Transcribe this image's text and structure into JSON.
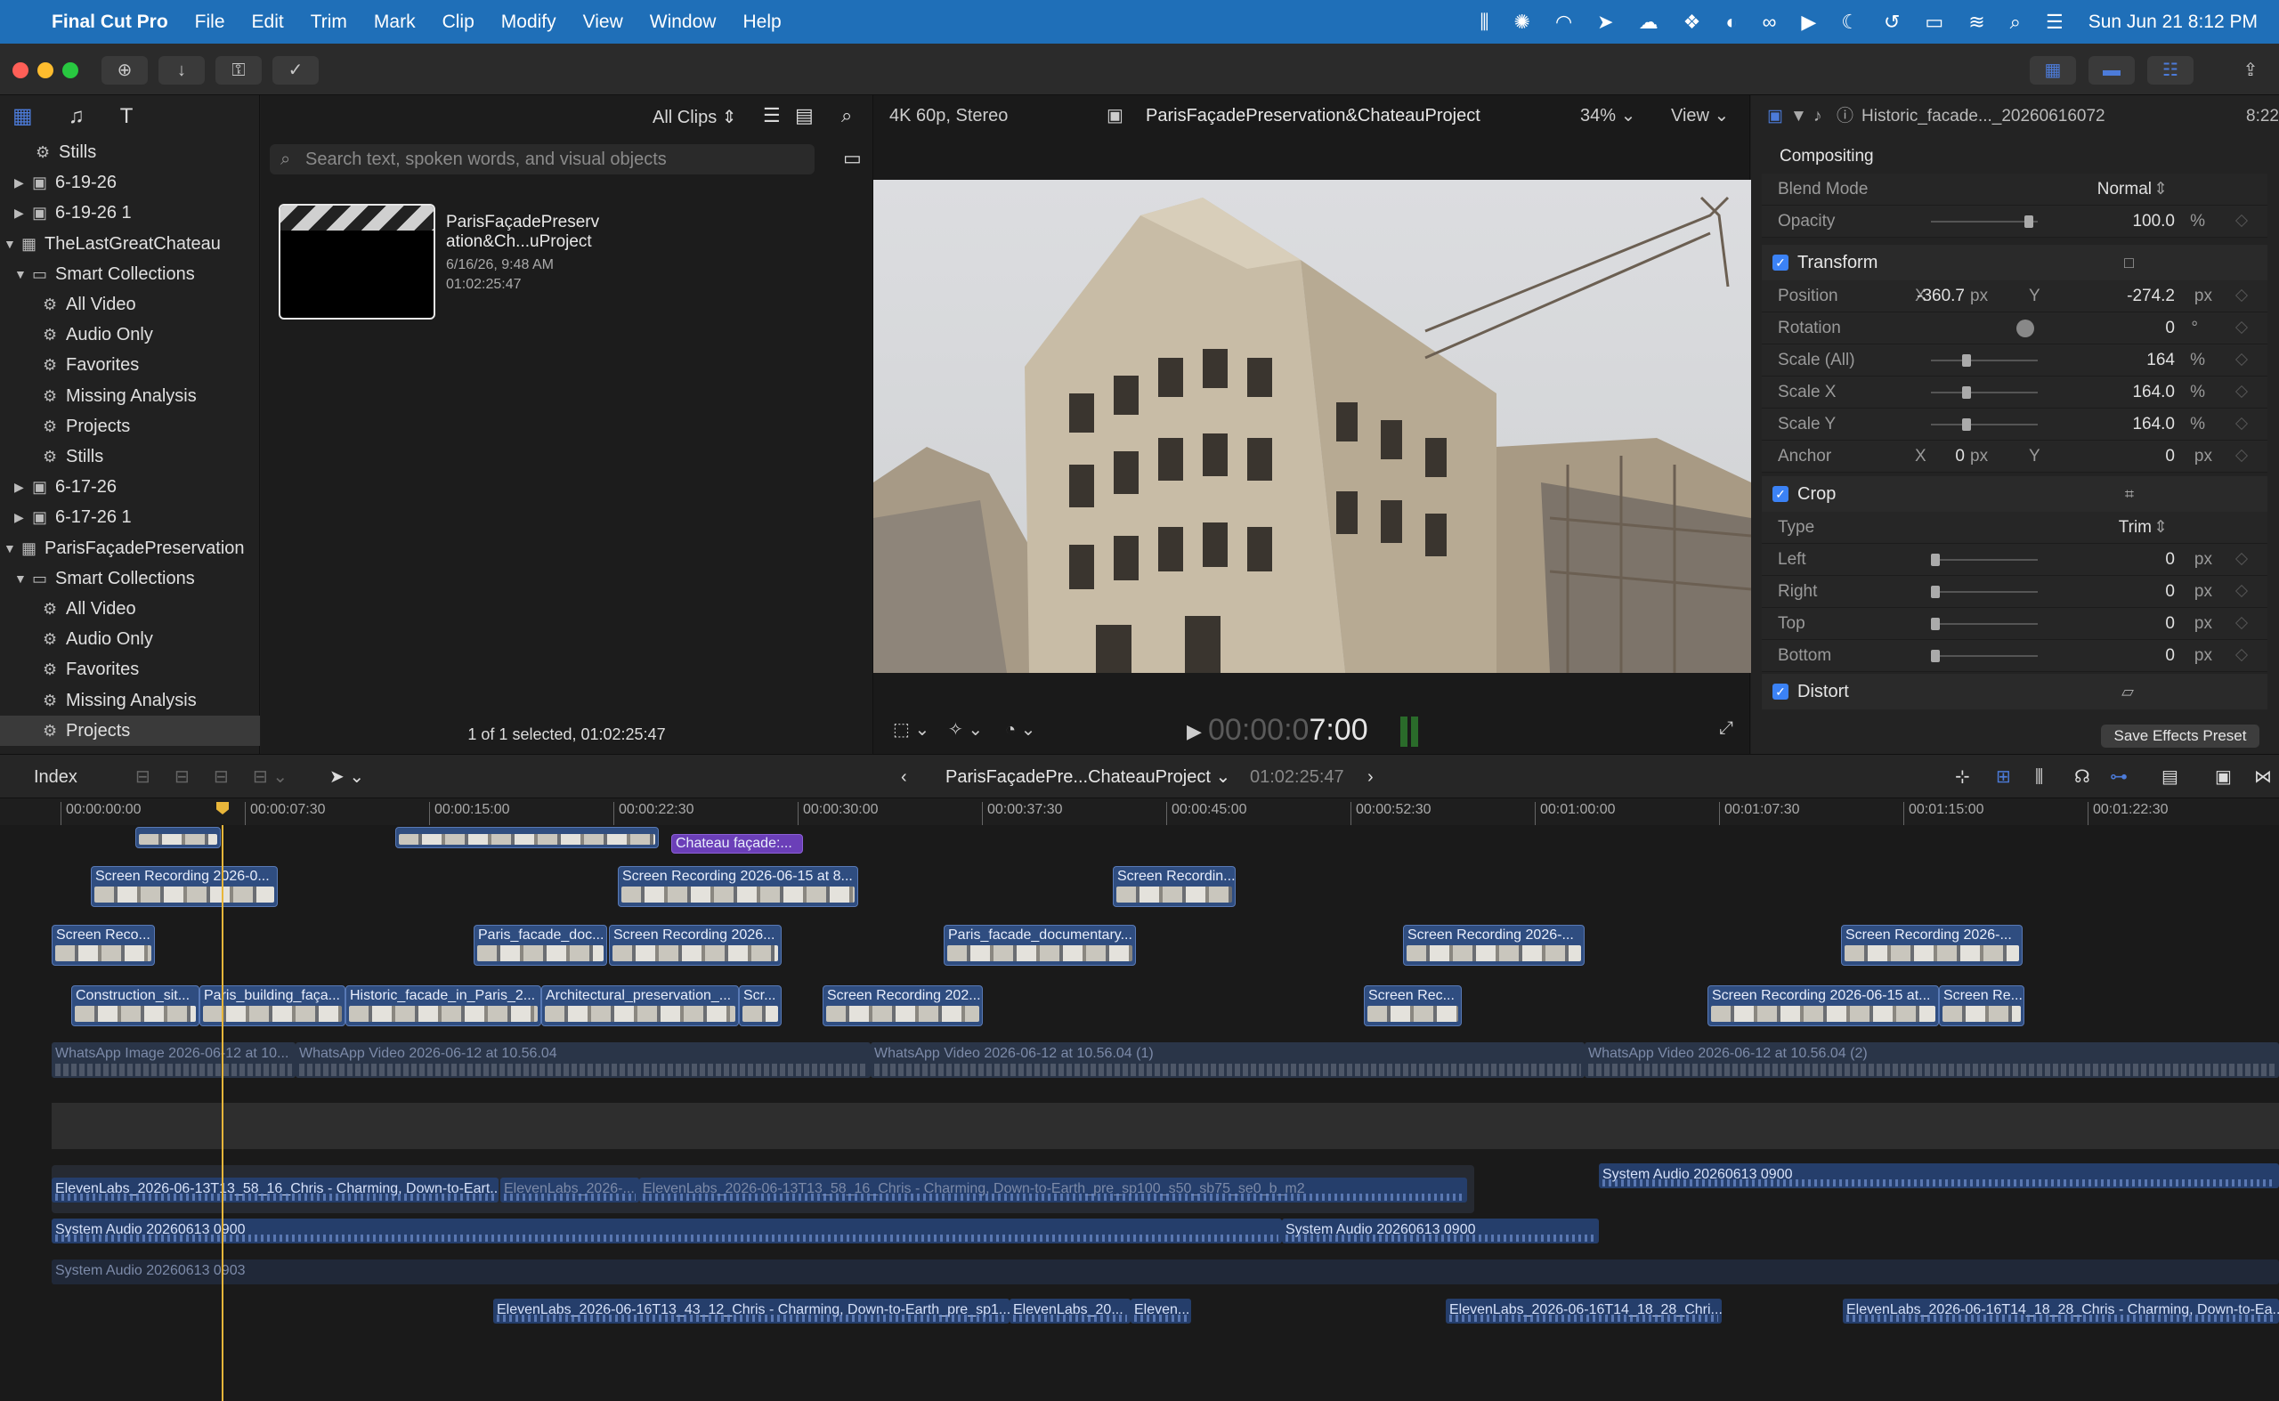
{
  "menubar": {
    "app": "Final Cut Pro",
    "items": [
      "File",
      "Edit",
      "Trim",
      "Mark",
      "Clip",
      "Modify",
      "View",
      "Window",
      "Help"
    ],
    "datetime": "Sun Jun 21  8:12 PM"
  },
  "library": {
    "rows": [
      {
        "label": "Stills",
        "indent": 40,
        "icon": "gear",
        "tri": ""
      },
      {
        "label": "6-19-26",
        "indent": 36,
        "icon": "event",
        "tri": "▶"
      },
      {
        "label": "6-19-26 1",
        "indent": 36,
        "icon": "event",
        "tri": "▶"
      },
      {
        "label": "TheLastGreatChateau",
        "indent": 24,
        "icon": "library",
        "tri": "▼"
      },
      {
        "label": "Smart Collections",
        "indent": 36,
        "icon": "folder",
        "tri": "▼"
      },
      {
        "label": "All Video",
        "indent": 48,
        "icon": "gear",
        "tri": ""
      },
      {
        "label": "Audio Only",
        "indent": 48,
        "icon": "gear",
        "tri": ""
      },
      {
        "label": "Favorites",
        "indent": 48,
        "icon": "gear",
        "tri": ""
      },
      {
        "label": "Missing Analysis",
        "indent": 48,
        "icon": "gear",
        "tri": ""
      },
      {
        "label": "Projects",
        "indent": 48,
        "icon": "gear",
        "tri": ""
      },
      {
        "label": "Stills",
        "indent": 48,
        "icon": "gear",
        "tri": ""
      },
      {
        "label": "6-17-26",
        "indent": 36,
        "icon": "event",
        "tri": "▶"
      },
      {
        "label": "6-17-26 1",
        "indent": 36,
        "icon": "event",
        "tri": "▶"
      },
      {
        "label": "ParisFaçadePreservation",
        "indent": 24,
        "icon": "library",
        "tri": "▼"
      },
      {
        "label": "Smart Collections",
        "indent": 36,
        "icon": "folder",
        "tri": "▼"
      },
      {
        "label": "All Video",
        "indent": 48,
        "icon": "gear",
        "tri": ""
      },
      {
        "label": "Audio Only",
        "indent": 48,
        "icon": "gear",
        "tri": ""
      },
      {
        "label": "Favorites",
        "indent": 48,
        "icon": "gear",
        "tri": ""
      },
      {
        "label": "Missing Analysis",
        "indent": 48,
        "icon": "gear",
        "tri": ""
      },
      {
        "label": "Projects",
        "indent": 48,
        "icon": "gear",
        "tri": "",
        "selected": true
      }
    ]
  },
  "browser": {
    "filter": "All Clips",
    "search_placeholder": "Search text, spoken words, and visual objects",
    "clip": {
      "title_line1": "ParisFaçadePreserv",
      "title_line2": "ation&Ch...uProject",
      "date": "6/16/26, 9:48 AM",
      "duration": "01:02:25:47"
    },
    "footer": "1 of 1 selected, 01:02:25:47"
  },
  "viewer": {
    "format": "4K 60p, Stereo",
    "project": "ParisFaçadePreservation&ChateauProject",
    "zoom": "34%",
    "view": "View",
    "timecode_dim": "00:00:0",
    "timecode_bright": "7:00"
  },
  "inspector": {
    "clip_name": "Historic_facade..._20260616072",
    "clip_time": "8:22",
    "compositing": "Compositing",
    "blend_mode_label": "Blend Mode",
    "blend_mode": "Normal",
    "opacity_label": "Opacity",
    "opacity": "100.0",
    "pct": "%",
    "transform": "Transform",
    "position_label": "Position",
    "x": "X",
    "y": "Y",
    "pos_x": "-360.7",
    "pos_y": "-274.2",
    "px": "px",
    "rotation_label": "Rotation",
    "rotation": "0",
    "deg": "°",
    "scale_all_label": "Scale (All)",
    "scale_all": "164",
    "scale_x_label": "Scale X",
    "scale_x": "164.0",
    "scale_y_label": "Scale Y",
    "scale_y": "164.0",
    "anchor_label": "Anchor",
    "anchor_x": "0",
    "anchor_y": "0",
    "crop": "Crop",
    "type_label": "Type",
    "type": "Trim",
    "left_label": "Left",
    "right_label": "Right",
    "top_label": "Top",
    "bottom_label": "Bottom",
    "zero": "0",
    "distort": "Distort",
    "save_preset": "Save Effects Preset"
  },
  "timeline": {
    "index": "Index",
    "project": "ParisFaçadePre...ChateauProject",
    "duration": "01:02:25:47",
    "ruler": [
      "00:00:00:00",
      "00:00:07:30",
      "00:00:15:00",
      "00:00:22:30",
      "00:00:30:00",
      "00:00:37:30",
      "00:00:45:00",
      "00:00:52:30",
      "00:01:00:00",
      "00:01:07:30",
      "00:01:15:00",
      "00:01:22:30"
    ],
    "title_clip": "Chateau façade:...",
    "clips": [
      "Screen Recording 2026-0...",
      "Screen Recording 2026-06-15 at 8...",
      "Screen Recordin...",
      "Screen Reco...",
      "Paris_facade_doc...",
      "Screen Recording 2026...",
      "Paris_facade_documentary...",
      "Screen Recording 2026-...",
      "Screen Recording 2026-...",
      "Construction_sit...",
      "Paris_building_faça...",
      "Historic_facade_in_Paris_2...",
      "Architectural_preservation_...",
      "Scr...",
      "Screen Recording 202...",
      "Screen Rec...",
      "Screen Recording 2026-06-15 at...",
      "Screen Re..."
    ],
    "primary": [
      "WhatsApp Image 2026-06-12 at 10...",
      "WhatsApp Video 2026-06-12 at 10.56.04",
      "WhatsApp Video 2026-06-12 at 10.56.04 (1)",
      "WhatsApp Video 2026-06-12 at 10.56.04 (2)"
    ],
    "audio": [
      "ElevenLabs_2026-06-13T13_58_16_Chris - Charming, Down-to-Eart...",
      "ElevenLabs_2026-...",
      "ElevenLabs_2026-06-13T13_58_16_Chris - Charming, Down-to-Earth_pre_sp100_s50_sb75_se0_b_m2",
      "System Audio 20260613 0900",
      "System Audio 20260613 0900",
      "System Audio 20260613 0900",
      "System Audio 20260613 0903",
      "ElevenLabs_2026-06-16T13_43_12_Chris - Charming, Down-to-Earth_pre_sp1...",
      "ElevenLabs_20...",
      "Eleven...",
      "ElevenLabs_2026-06-16T14_18_28_Chri...",
      "ElevenLabs_2026-06-16T14_18_28_Chris - Charming, Down-to-Ea..."
    ]
  }
}
